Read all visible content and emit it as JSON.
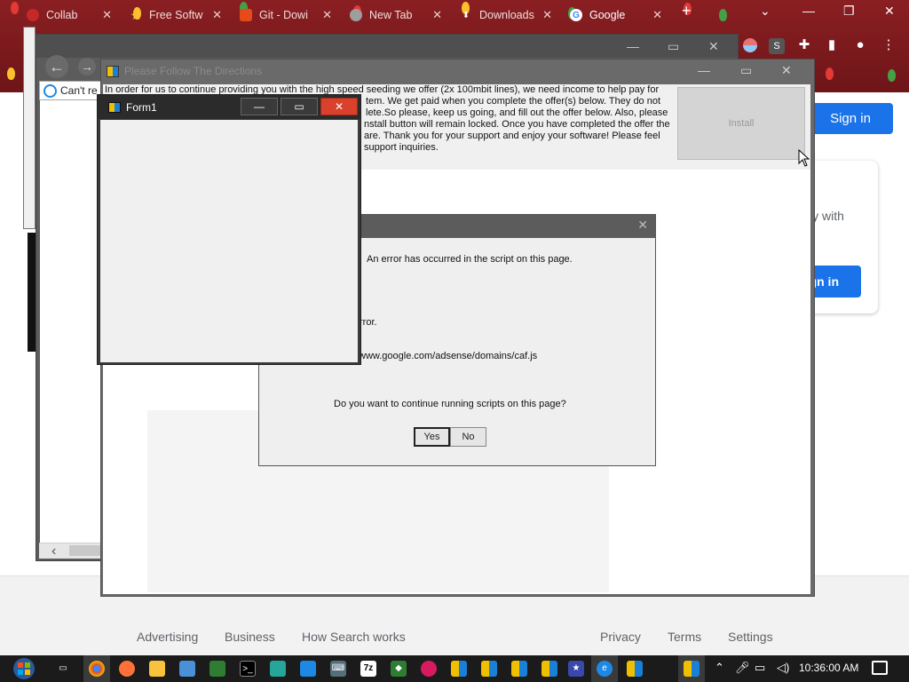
{
  "browser": {
    "tabs": [
      {
        "label": "Collab",
        "favicon": "red-dot-icon"
      },
      {
        "label": "Free Softw",
        "favicon": "star-icon"
      },
      {
        "label": "Git - Dowi",
        "favicon": "git-icon"
      },
      {
        "label": "New Tab",
        "favicon": "chrome-icon"
      },
      {
        "label": "Downloads",
        "favicon": "download-icon"
      },
      {
        "label": "Google",
        "favicon": "google-icon"
      }
    ],
    "new_tab_symbol": "+",
    "close_symbol": "✕",
    "profile_initial": "S"
  },
  "google": {
    "signin_label": "Sign in",
    "card_text": "ly with",
    "card_signin_label": "gn in",
    "footer_left": [
      "Advertising",
      "Business",
      "How Search works"
    ],
    "footer_right": [
      "Privacy",
      "Terms",
      "Settings"
    ]
  },
  "ie_window": {
    "address_text": "Can't re"
  },
  "directions_window": {
    "title": "Please Follow The Directions",
    "text_lines": [
      "In order for us to continue providing you with the high speed seeding we offer (2x 100mbit lines), we need income to help pay for the",
      "tem. We get paid when you complete the offer(s) below. They do not",
      "lete.So please, keep us going, and fill out the offer below. Also, please",
      "nstall button will remain locked. Once you have completed the offer the",
      "are. Thank you for your support and enjoy your software! Please feel",
      "support inquiries."
    ],
    "install_label": "Install"
  },
  "error_dialog": {
    "message": "An error has occurred in the script on this page.",
    "error_fragment": "rror.",
    "url_fragment": "www.google.com/adsense/domains/caf.js",
    "question": "Do you want to continue running scripts on this page?",
    "yes_label": "Yes",
    "no_label": "No"
  },
  "form1": {
    "title": "Form1"
  },
  "taskbar": {
    "clock": "10:36:00 AM"
  }
}
